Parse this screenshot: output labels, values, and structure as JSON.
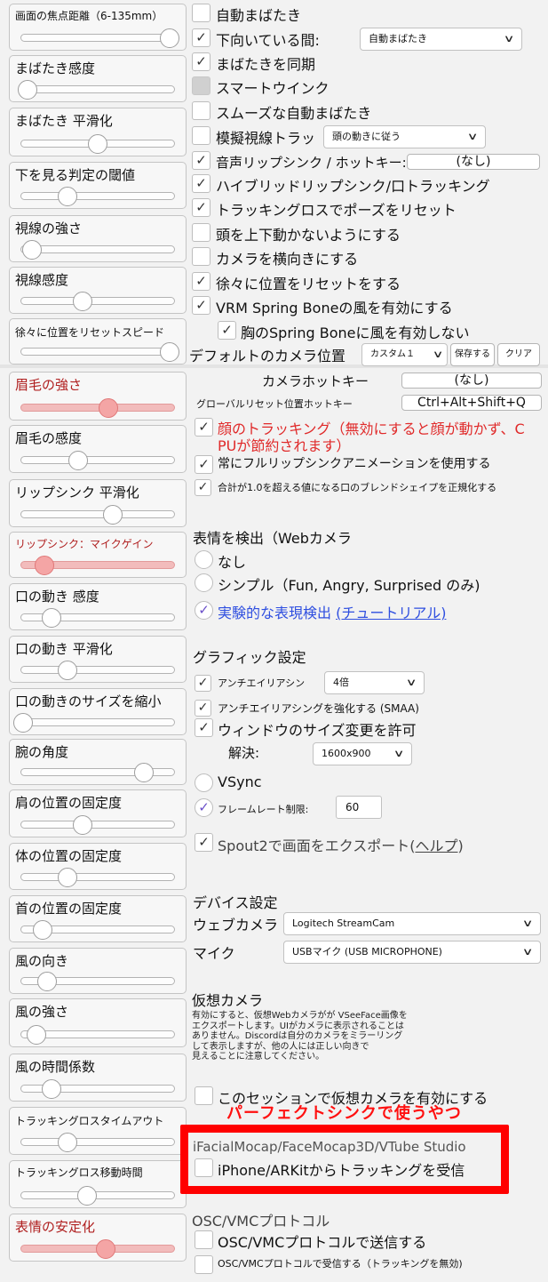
{
  "left_sliders": [
    {
      "label": "画面の焦点距離（6-135mm）",
      "value": 0.97,
      "size": "s"
    },
    {
      "label": "まばたき感度",
      "value": 0.04
    },
    {
      "label": "まばたき 平滑化",
      "value": 0.5
    },
    {
      "label": "下を見る判定の閾値",
      "value": 0.3
    },
    {
      "label": "視線の強さ",
      "value": 0.07
    },
    {
      "label": "視線感度",
      "value": 0.4
    },
    {
      "label": "徐々に位置をリセットスピード",
      "value": 0.97,
      "size": "xs"
    },
    {
      "label": "眉毛の強さ",
      "value": 0.57,
      "accent": "red"
    },
    {
      "label": "眉毛の感度",
      "value": 0.37
    },
    {
      "label": "リップシンク 平滑化",
      "value": 0.6
    },
    {
      "label": "リップシンク：マイクゲイン",
      "value": 0.15,
      "size": "s",
      "accent": "red"
    },
    {
      "label": "口の動き 感度",
      "value": 0.2
    },
    {
      "label": "口の動き 平滑化",
      "value": 0.3
    },
    {
      "label": "口の動きのサイズを縮小",
      "value": 0.01
    },
    {
      "label": "腕の角度",
      "value": 0.8
    },
    {
      "label": "肩の位置の固定度",
      "value": 0.4
    },
    {
      "label": "体の位置の固定度",
      "value": 0.3
    },
    {
      "label": "首の位置の固定度",
      "value": 0.14
    },
    {
      "label": "風の向き",
      "value": 0.17
    },
    {
      "label": "風の強さ",
      "value": 0.1
    },
    {
      "label": "風の時間係数",
      "value": 0.2
    },
    {
      "label": "トラッキングロスタイムアウト",
      "value": 0.3,
      "size": "xs"
    },
    {
      "label": "トラッキングロス移動時間",
      "value": 0.43,
      "size": "s"
    },
    {
      "label": "表情の安定化",
      "value": 0.55,
      "accent": "red"
    }
  ],
  "options": {
    "auto_blink": {
      "label": "自動まばたき",
      "checked": false
    },
    "look_down": {
      "label": "下向いている間:",
      "checked": true,
      "select": "自動まばたき"
    },
    "sync_blink": {
      "label": "まばたきを同期",
      "checked": true
    },
    "smart_wink": {
      "label": "スマートウインク",
      "checked": false,
      "disabled": true
    },
    "smooth_blink": {
      "label": "スムーズな自動まばたき",
      "checked": false
    },
    "sim_gaze": {
      "label": "模擬視線トラッ",
      "checked": false,
      "select": "頭の動きに従う"
    },
    "voice_lipsync": {
      "label": "音声リップシンク / ホットキー:",
      "checked": true,
      "hotkey": "(なし)"
    },
    "hybrid_lipsync": {
      "label": "ハイブリッドリップシンク/口トラッキング",
      "checked": true
    },
    "reset_pose": {
      "label": "トラッキングロスでポーズをリセット",
      "checked": true
    },
    "head_lock": {
      "label": "頭を上下動かないようにする",
      "checked": false
    },
    "camera_side": {
      "label": "カメラを横向きにする",
      "checked": false
    },
    "gradual_reset": {
      "label": "徐々に位置をリセットをする",
      "checked": true
    },
    "vrm_wind": {
      "label": "VRM Spring Boneの風を有効にする",
      "checked": true
    },
    "chest_wind": {
      "label": "胸のSpring Boneに風を有効しない",
      "checked": true
    }
  },
  "camera_position": {
    "label": "デフォルトのカメラ位置",
    "select": "カスタム１",
    "save": "保存する",
    "clear": "クリア"
  },
  "camera_hotkey": {
    "label": "カメラホットキー",
    "value": "(なし)"
  },
  "global_reset": {
    "label": "グローバルリセット位置ホットキー",
    "value": "Ctrl+Alt+Shift+Q"
  },
  "face_tracking": {
    "label": "顔のトラッキング（無効にすると顔が動かず、C",
    "label2": "PUが節約されます）",
    "checked": true
  },
  "full_lipsync": {
    "label": "常にフルリップシンクアニメーションを使用する",
    "checked": true
  },
  "normalize_blend": {
    "label": "合計が1.0を超える値になる口のブレンドシェイプを正規化する",
    "checked": true
  },
  "expression": {
    "title": "表情を検出（Webカメラ",
    "none": "なし",
    "simple": "シンプル（Fun, Angry, Surprised のみ)",
    "experimental": "実験的な表現検出",
    "tutorial": "(チュートリアル)",
    "selected": "experimental"
  },
  "graphics": {
    "title": "グラフィック設定",
    "aa_label": "アンチエイリアシン",
    "aa_value": "4倍",
    "smaa": "アンチエイリアシングを強化する (SMAA)",
    "resize": "ウィンドウのサイズ変更を許可",
    "res_label": "解決:",
    "res_value": "1600x900",
    "vsync": "VSync",
    "fps_label": "フレームレート制限:",
    "fps_value": "60",
    "spout": "Spout2で画面をエクスポート(",
    "spout_help": "ヘルプ",
    "spout_end": ")"
  },
  "device": {
    "title": "デバイス設定",
    "webcam_label": "ウェブカメラ",
    "webcam_value": "Logitech StreamCam",
    "mic_label": "マイク",
    "mic_value": "USBマイク (USB MICROPHONE)"
  },
  "virtual_camera": {
    "title": "仮想カメラ",
    "desc": [
      "有効にすると、仮想Webカメラがが VSeeFace画像を",
      "エクスポートします。UIがカメラに表示されることは",
      "ありません。Discordは自分のカメラをミラーリング",
      "して表示しますが、他の人には正しい向きで",
      "見えることに注意してください。"
    ],
    "enable": "このセッションで仮想カメラを有効にする"
  },
  "annotation": "パーフェクトシンクで使うやつ",
  "ifacial": {
    "title": "iFacialMocap/FaceMocap3D/VTube Studio",
    "receive": "iPhone/ARKitからトラッキングを受信"
  },
  "osc": {
    "title": "OSC/VMCプロトコル",
    "send": "OSC/VMCプロトコルで送信する",
    "receive": "OSC/VMCプロトコルで受信する（トラッキングを無効)"
  },
  "check_glyph": "✓",
  "colors": {
    "accent_red": "#e02a2a",
    "annotation_red": "#ff0000",
    "link_blue": "#2f4fe0"
  }
}
